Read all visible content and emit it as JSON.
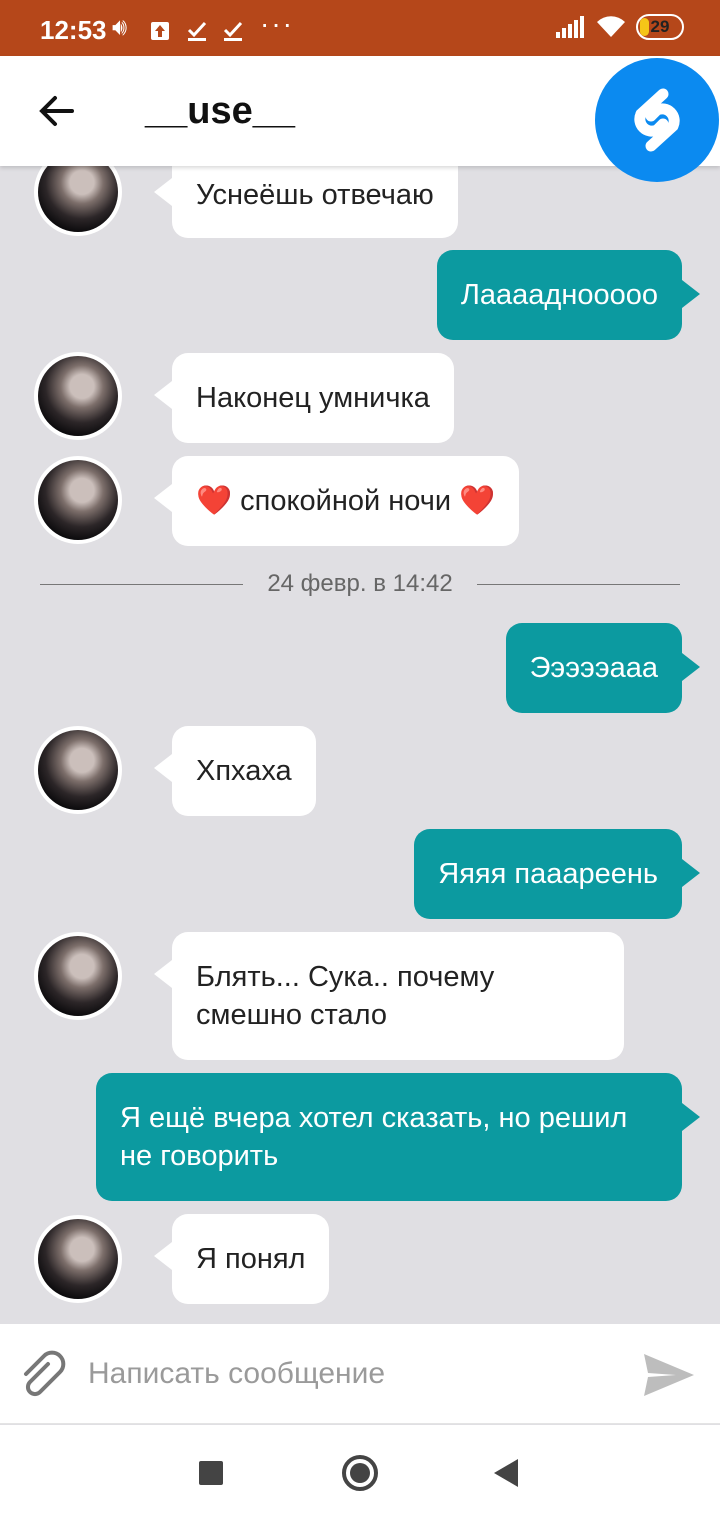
{
  "status_bar": {
    "time": "12:53",
    "battery": "29",
    "battery_level_percent": 29
  },
  "header": {
    "title": "__use__"
  },
  "messages": [
    {
      "dir": "in",
      "text": "Уснеёшь отвечаю"
    },
    {
      "dir": "out",
      "text": "Лааааднооооо"
    },
    {
      "dir": "in",
      "text": "Наконец умничка"
    },
    {
      "dir": "in",
      "text": "❤️ спокойной ночи ❤️"
    },
    {
      "dir": "out",
      "text": "Эээээааа"
    },
    {
      "dir": "in",
      "text": "Хпхаха"
    },
    {
      "dir": "out",
      "text": "Яяяя паааpeeнь"
    },
    {
      "dir": "in",
      "text": "Блять... Сука.. почему смешно стало"
    },
    {
      "dir": "out",
      "text": "Я ещё вчера хотел сказать, но решил не говорить"
    },
    {
      "dir": "in",
      "text": "Я понял"
    }
  ],
  "date_divider": "24 февр. в 14:42",
  "composer": {
    "placeholder": "Написать сообщение"
  },
  "colors": {
    "status_bar": "#b5471a",
    "outgoing_bubble": "#0c9aa0",
    "chat_bg": "#e0dfe3",
    "shazam": "#0b8af0"
  }
}
